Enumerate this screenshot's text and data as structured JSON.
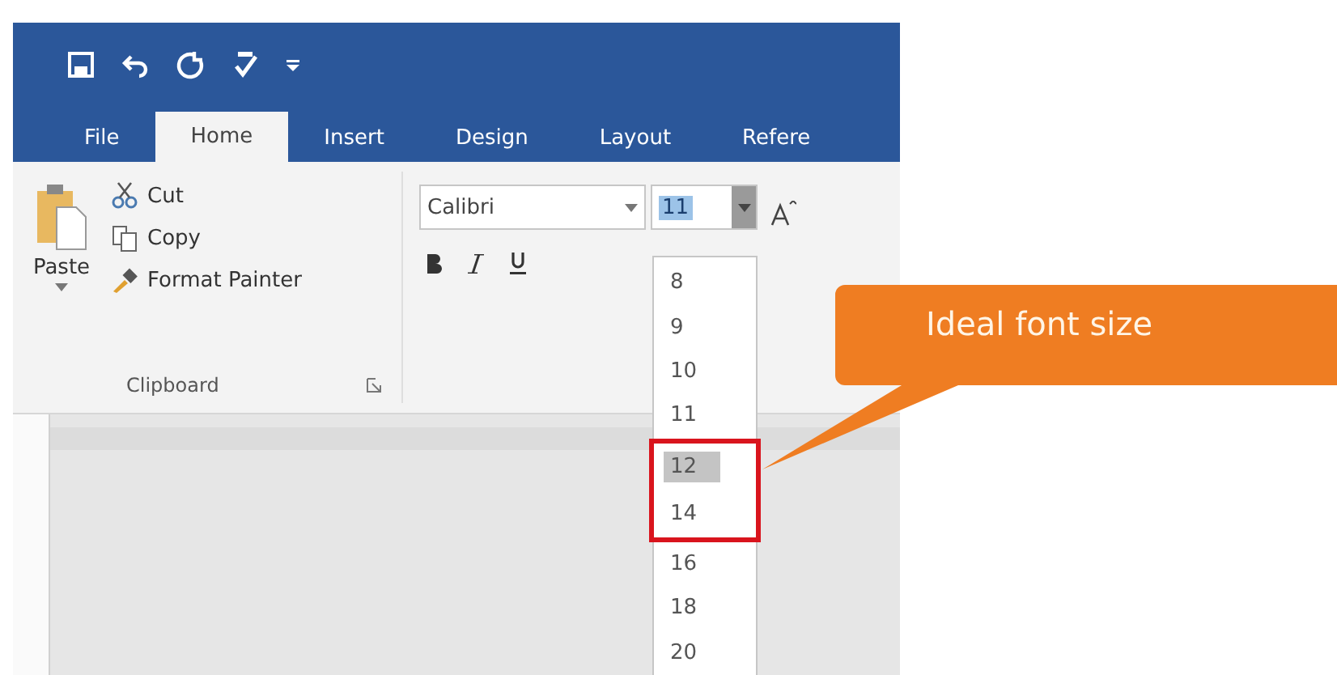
{
  "tabs": [
    {
      "label": "File",
      "selected": false
    },
    {
      "label": "Home",
      "selected": true
    },
    {
      "label": "Insert",
      "selected": false
    },
    {
      "label": "Design",
      "selected": false
    },
    {
      "label": "Layout",
      "selected": false
    },
    {
      "label": "Refere",
      "selected": false
    }
  ],
  "clipboard": {
    "paste": "Paste",
    "cut": "Cut",
    "copy": "Copy",
    "format_painter": "Format Painter",
    "group_label": "Clipboard"
  },
  "font": {
    "name": "Calibri",
    "size": "11"
  },
  "size_list": [
    {
      "label": "8",
      "selected": false
    },
    {
      "label": "9",
      "selected": false
    },
    {
      "label": "10",
      "selected": false
    },
    {
      "label": "11",
      "selected": false
    },
    {
      "label": "12",
      "selected": true
    },
    {
      "label": "14",
      "selected": false
    },
    {
      "label": "16",
      "selected": false
    },
    {
      "label": "18",
      "selected": false
    },
    {
      "label": "20",
      "selected": false
    }
  ],
  "callout": {
    "text": "Ideal font size"
  }
}
